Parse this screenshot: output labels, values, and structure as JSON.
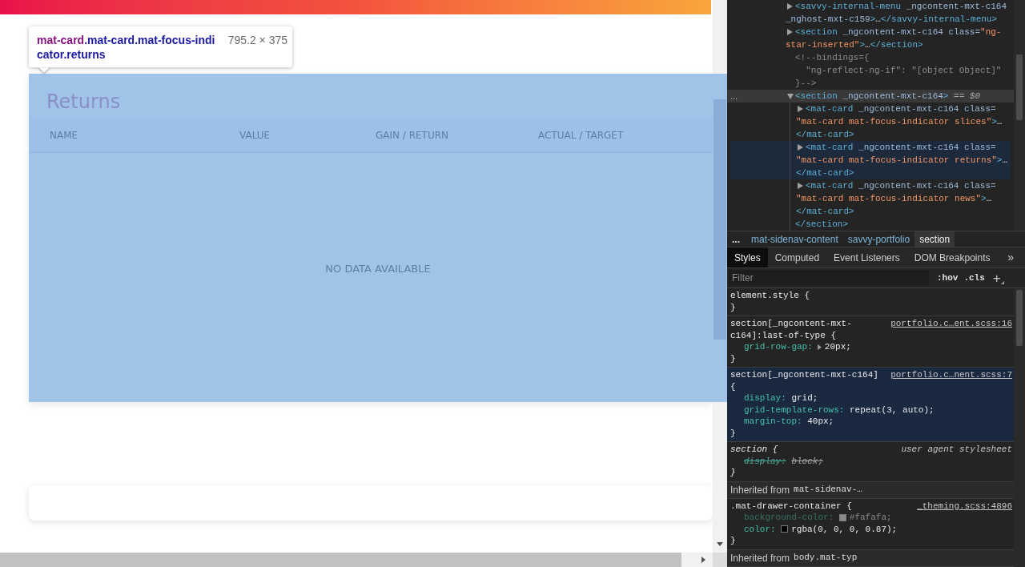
{
  "page": {
    "tooltip": {
      "tag": "mat-card",
      "classes": ".mat-card.mat-focus-indicator.returns",
      "size": "795.2 × 375"
    },
    "returns_card": {
      "highlighted": true,
      "title": "Returns",
      "columns": [
        "NAME",
        "VALUE",
        "GAIN / RETURN",
        "ACTUAL / TARGET"
      ],
      "empty_message": "NO DATA AVAILABLE"
    }
  },
  "devtools": {
    "elements": {
      "nodes": [
        {
          "kind": "element",
          "expanded": false,
          "selected": false,
          "hovered": false,
          "lines": [
            "<savvy-internal-menu _ngcontent-mxt-c164",
            "_nghost-mxt-c159>…</savvy-internal-menu>"
          ]
        },
        {
          "kind": "element",
          "expanded": false,
          "selected": false,
          "hovered": false,
          "lines": [
            "<section _ngcontent-mxt-c164 class=\"ng-",
            "star-inserted\">…</section>"
          ]
        },
        {
          "kind": "comment",
          "selected": false,
          "hovered": false,
          "lines": [
            "<!--bindings={",
            "  \"ng-reflect-ng-if\": \"[object Object]\"",
            "}-->"
          ]
        },
        {
          "kind": "element",
          "expanded": true,
          "selected": true,
          "hovered": false,
          "gutter": "...",
          "marker": "== *$0*",
          "lines": [
            "<section _ngcontent-mxt-c164>"
          ],
          "closing": "</section>",
          "children": [
            {
              "kind": "element",
              "expanded": false,
              "selected": false,
              "hovered": false,
              "lines": [
                "<mat-card _ngcontent-mxt-c164 class=",
                "\"mat-card mat-focus-indicator slices\">…",
                "</mat-card>"
              ]
            },
            {
              "kind": "element",
              "expanded": false,
              "selected": false,
              "hovered": true,
              "lines": [
                "<mat-card _ngcontent-mxt-c164 class=",
                "\"mat-card mat-focus-indicator returns\">…",
                "</mat-card>"
              ]
            },
            {
              "kind": "element",
              "expanded": false,
              "selected": false,
              "hovered": false,
              "lines": [
                "<mat-card _ngcontent-mxt-c164 class=",
                "\"mat-card mat-focus-indicator news\">…",
                "</mat-card>"
              ]
            }
          ]
        }
      ]
    },
    "breadcrumbs": {
      "overflow": "...",
      "items": [
        {
          "label": "mat-sidenav-content",
          "selected": false
        },
        {
          "label": "savvy-portfolio",
          "selected": false
        },
        {
          "label": "section",
          "selected": true
        }
      ]
    },
    "styles_pane": {
      "tabs": [
        {
          "label": "Styles",
          "selected": true
        },
        {
          "label": "Computed",
          "selected": false
        },
        {
          "label": "Event Listeners",
          "selected": false
        },
        {
          "label": "DOM Breakpoints",
          "selected": false
        }
      ],
      "more": "»",
      "filter": {
        "placeholder": "Filter"
      },
      "toggles": [
        ":hov",
        ".cls"
      ],
      "add": "+",
      "rules": [
        {
          "kind": "rule",
          "highlighted": false,
          "user_agent": false,
          "selector": [
            "element.style {"
          ],
          "close": "}"
        },
        {
          "kind": "rule",
          "highlighted": false,
          "user_agent": false,
          "selector": [
            "section[_ngcontent-mxt-",
            "c164]:last-of-type {"
          ],
          "source": "portfolio.c…ent.scss:16",
          "properties": [
            {
              "name": "grid-row-gap:",
              "value": "20px;",
              "expandable": true,
              "overridden": false,
              "inactive": false
            }
          ],
          "close": "}"
        },
        {
          "kind": "rule",
          "highlighted": true,
          "user_agent": false,
          "selector": [
            "section[_ngcontent-mxt-c164]",
            "{"
          ],
          "source": "portfolio.c…nent.scss:7",
          "properties": [
            {
              "name": "display:",
              "value": "grid;",
              "expandable": false,
              "overridden": false,
              "inactive": false
            },
            {
              "name": "grid-template-rows:",
              "value": "repeat(3, auto);",
              "expandable": false,
              "overridden": false,
              "inactive": false
            },
            {
              "name": "margin-top:",
              "value": "40px;",
              "expandable": false,
              "overridden": false,
              "inactive": false
            }
          ],
          "close": "}"
        },
        {
          "kind": "rule",
          "highlighted": false,
          "user_agent": true,
          "selector": [
            "section {"
          ],
          "source": "user agent stylesheet",
          "properties": [
            {
              "name": "display:",
              "value": "block;",
              "expandable": false,
              "overridden": true,
              "inactive": false
            }
          ],
          "close": "}"
        },
        {
          "kind": "inherited",
          "label": "Inherited from",
          "selector": "mat-sidenav-…"
        },
        {
          "kind": "rule",
          "highlighted": false,
          "user_agent": false,
          "selector": [
            ".mat-drawer-container {"
          ],
          "source": "_theming.scss:4896",
          "properties": [
            {
              "name": "background-color:",
              "value": "#fafafa;",
              "color": "#8a8a8a",
              "expandable": false,
              "overridden": false,
              "inactive": true
            },
            {
              "name": "color:",
              "value": "rgba(0, 0, 0, 0.87);",
              "color": "#000000",
              "expandable": false,
              "overridden": false,
              "inactive": false
            }
          ],
          "close": "}"
        },
        {
          "kind": "inherited",
          "label": "Inherited from",
          "selector": "body.mat-typ"
        }
      ]
    }
  }
}
